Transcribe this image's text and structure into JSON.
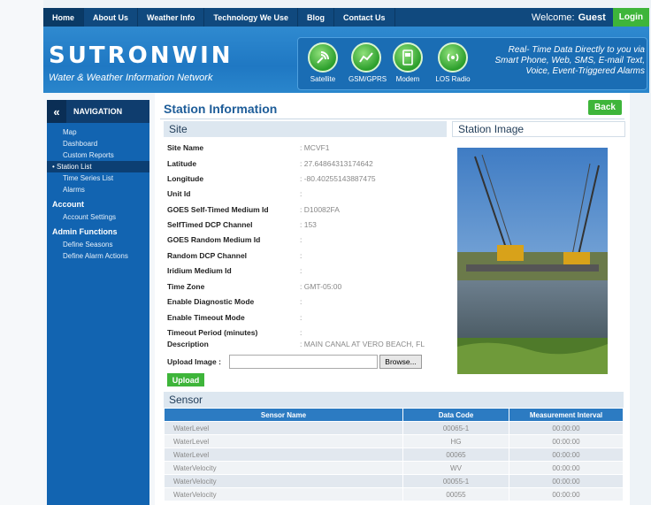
{
  "topnav": {
    "items": [
      "Home",
      "About Us",
      "Weather Info",
      "Technology We Use",
      "Blog",
      "Contact Us"
    ],
    "welcome": "Welcome:",
    "user": "Guest",
    "login": "Login"
  },
  "banner": {
    "title": "SUTRONWIN",
    "subtitle": "Water & Weather Information Network",
    "comm": [
      "Satellite",
      "GSM/GPRS",
      "Modem",
      "LOS Radio"
    ],
    "tagline": "Real- Time Data Directly to you via Smart Phone, Web, SMS, E-mail Text, Voice, Event-Triggered Alarms"
  },
  "sidebar": {
    "header": "NAVIGATION",
    "collapse": "«",
    "items": [
      "Map",
      "Dashboard",
      "Custom Reports",
      "Station List",
      "Time Series List",
      "Alarms"
    ],
    "account_title": "Account",
    "account_items": [
      "Account Settings"
    ],
    "admin_title": "Admin Functions",
    "admin_items": [
      "Define Seasons",
      "Define Alarm Actions"
    ]
  },
  "main": {
    "title": "Station Information",
    "back": "Back",
    "site_heading": "Site",
    "image_heading": "Station Image",
    "fields": [
      {
        "label": "Site Name",
        "value": ": MCVF1"
      },
      {
        "label": "Latitude",
        "value": ": 27.64864313174642"
      },
      {
        "label": "Longitude",
        "value": ": -80.40255143887475"
      },
      {
        "label": "Unit Id",
        "value": ":"
      },
      {
        "label": "GOES Self-Timed Medium Id",
        "value": ": D10082FA"
      },
      {
        "label": "SelfTimed DCP Channel",
        "value": ": 153"
      },
      {
        "label": "GOES Random Medium Id",
        "value": ":"
      },
      {
        "label": "Random DCP Channel",
        "value": ":"
      },
      {
        "label": "Iridium Medium Id",
        "value": ":"
      },
      {
        "label": "Time Zone",
        "value": ": GMT-05:00"
      },
      {
        "label": "Enable Diagnostic Mode",
        "value": ":"
      },
      {
        "label": "Enable Timeout Mode",
        "value": ":"
      },
      {
        "label": "Timeout Period (minutes)",
        "value": ":"
      },
      {
        "label": "Description",
        "value": ": MAIN CANAL AT VERO BEACH, FL"
      }
    ],
    "upload_label": "Upload Image :",
    "browse": "Browse...",
    "upload_button": "Upload",
    "sensor_heading": "Sensor",
    "sensor_columns": [
      "Sensor Name",
      "Data Code",
      "Measurement Interval"
    ],
    "sensor_rows": [
      [
        "WaterLevel",
        "00065-1",
        "00:00:00"
      ],
      [
        "WaterLevel",
        "HG",
        "00:00:00"
      ],
      [
        "WaterLevel",
        "00065",
        "00:00:00"
      ],
      [
        "WaterVelocity",
        "WV",
        "00:00:00"
      ],
      [
        "WaterVelocity",
        "00055-1",
        "00:00:00"
      ],
      [
        "WaterVelocity",
        "00055",
        "00:00:00"
      ]
    ]
  }
}
